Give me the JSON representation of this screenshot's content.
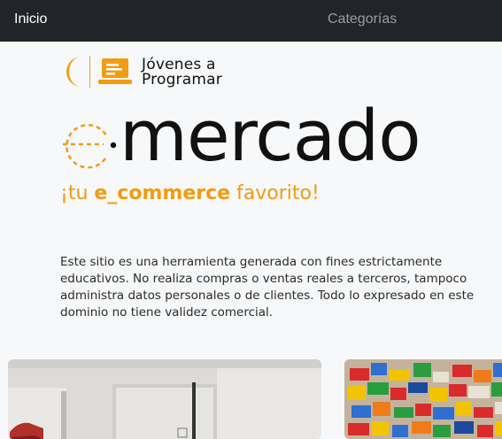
{
  "nav": {
    "home_label": "Inicio",
    "categories_label": "Categorías"
  },
  "logo": {
    "brand_lines": [
      "Jóvenes a",
      "Programar"
    ]
  },
  "hero": {
    "title": "mercado",
    "tagline_prefix": "¡tu ",
    "tagline_bold": "e_commerce",
    "tagline_suffix": " favorito!",
    "accent_color": "#f39c12"
  },
  "description": "Este sitio es una herramienta generada con fines estrictamente educativos. No realiza compras o ventas reales a terceros, tampoco administra datos personales o de clientes. Todo lo expresado en este dominio no tiene validez comercial.",
  "cards": [
    {
      "image": "showroom-photo"
    },
    {
      "image": "lego-bricks-photo"
    }
  ]
}
